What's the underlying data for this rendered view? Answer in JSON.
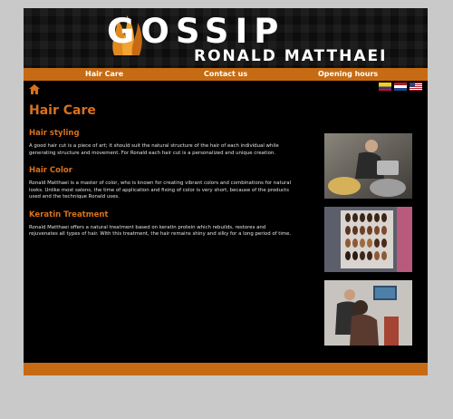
{
  "header": {
    "brand_title": "GOSSIP",
    "brand_subtitle": "RONALD MATTHAEI"
  },
  "nav": {
    "items": [
      {
        "label": "Hair Care"
      },
      {
        "label": "Contact us"
      },
      {
        "label": "Opening hours"
      }
    ]
  },
  "icons": {
    "home": "home-icon",
    "flags": [
      "flag-colombia",
      "flag-netherlands",
      "flag-usa"
    ]
  },
  "colors": {
    "accent": "#c66b13",
    "heading": "#d9711c",
    "background": "#000000",
    "page_bg": "#c9c9c9"
  },
  "content": {
    "title": "Hair Care",
    "sections": [
      {
        "heading": "Hair styling",
        "body": "A good hair cut is a piece of art; it should suit the natural structure of the hair of each individual while generating structure and movement. For Ronald each hair cut is a personalized and unique creation."
      },
      {
        "heading": "Hair Color",
        "body": "Ronald Matthaei is a master of color, who is known for creating vibrant colors and combinations for natural looks. Unlike most salons, the time of application and fixing of color is very short, because of the products used and the technique Ronald uses."
      },
      {
        "heading": "Keratin Treatment",
        "body": "Ronald Matthaei offers a natural treatment based on keratin protein which rebuilds, restores and rejuvenates all types of hair. With this treatment, the hair remains shiny and silky for a long period of time."
      }
    ]
  }
}
